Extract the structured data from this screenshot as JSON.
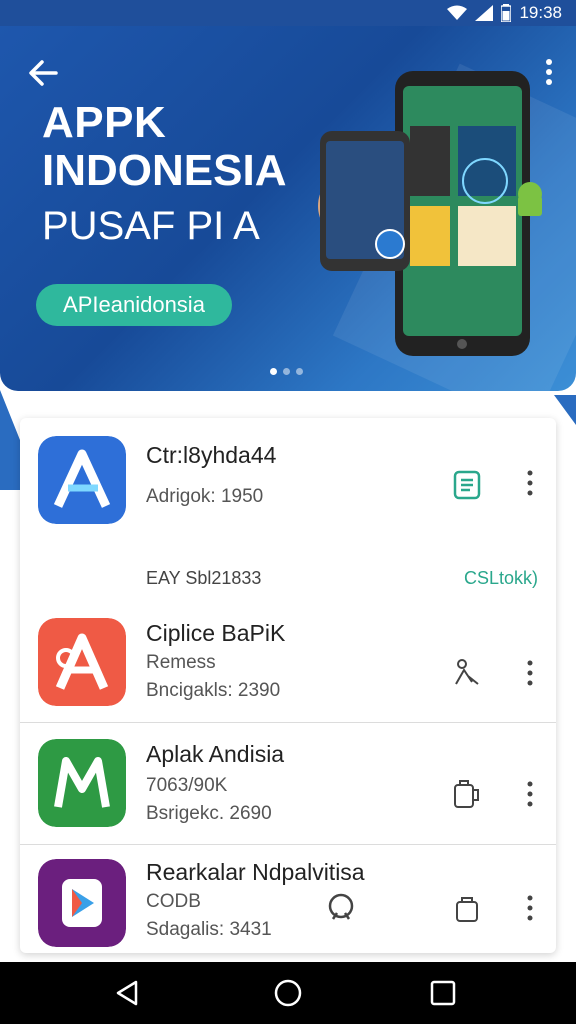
{
  "status": {
    "time": "19:38"
  },
  "hero": {
    "title_line1": "APPK",
    "title_line2": "INDONESIA",
    "subtitle": "PUSAF PI A",
    "cta_label": "APIeanidonsia",
    "carousel_count": 3,
    "carousel_active": 0
  },
  "apps": [
    {
      "name": "Ctr:l8yhda44",
      "line1": "Adrigok: 1950",
      "line2": "",
      "icon": "blue-a-app-icon",
      "action": "install-icon"
    },
    {
      "name": "Ciplice BaPiK",
      "line1": "Remess",
      "line2": "Bncigakls: 2390",
      "icon": "red-a-app-icon",
      "action": "person-share-icon"
    },
    {
      "name": "Aplak Andisia",
      "line1": "7063/90K",
      "line2": "Bsrigekc. 2690",
      "icon": "green-m-app-icon",
      "action": "mug-icon"
    },
    {
      "name": "Rearkalar Ndpalvitisa",
      "line1": "CODB",
      "line2": "Sdagalis: 3431",
      "icon": "purple-play-app-icon",
      "action": "bag-icon"
    }
  ],
  "section": {
    "label": "EAY Sbl21833",
    "link": "CSLtokk)"
  },
  "colors": {
    "hero_blue": "#1e57ad",
    "accent_teal": "#2fb89d",
    "link_green": "#2aa78c"
  }
}
